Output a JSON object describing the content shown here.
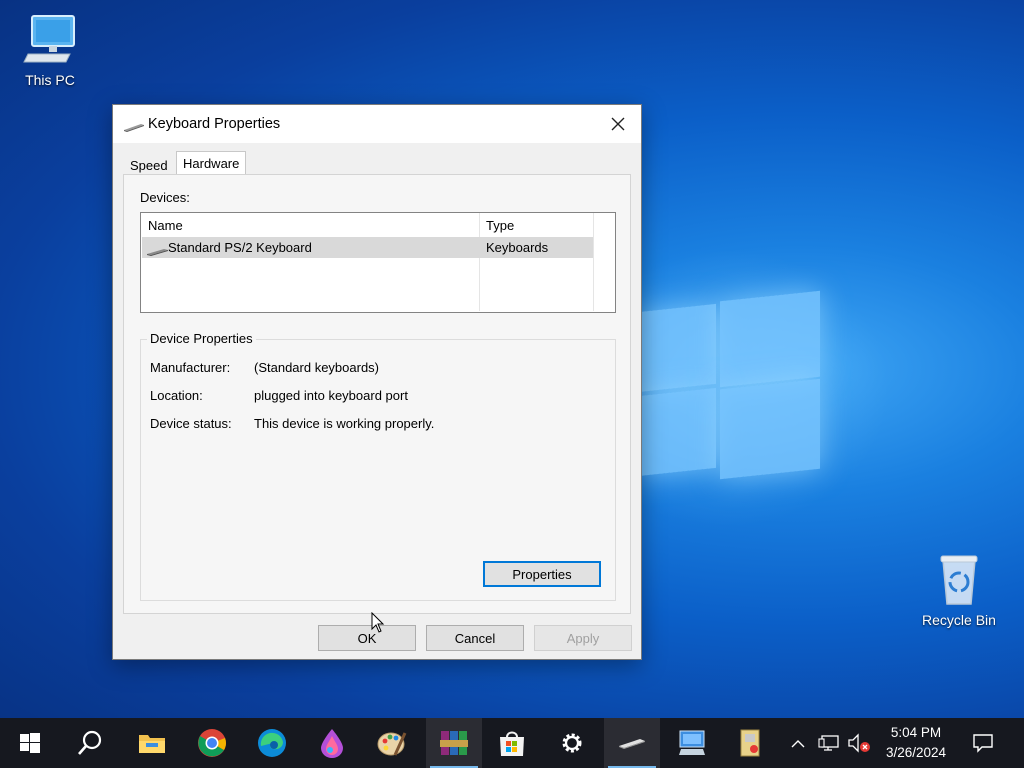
{
  "desktop": {
    "icons": [
      {
        "label": "This PC"
      },
      {
        "label": "Recycle Bin"
      }
    ]
  },
  "dialog": {
    "title": "Keyboard Properties",
    "tabs": [
      {
        "label": "Speed",
        "selected": false
      },
      {
        "label": "Hardware",
        "selected": true
      }
    ],
    "devices_label": "Devices:",
    "columns": {
      "name": "Name",
      "type": "Type"
    },
    "devices": [
      {
        "name": "Standard PS/2 Keyboard",
        "type": "Keyboards",
        "selected": true
      }
    ],
    "device_properties": {
      "legend": "Device Properties",
      "manufacturer_label": "Manufacturer:",
      "manufacturer": "(Standard keyboards)",
      "location_label": "Location:",
      "location": "plugged into keyboard port",
      "status_label": "Device status:",
      "status": "This device is working properly.",
      "properties_button": "Properties"
    },
    "buttons": {
      "ok": "OK",
      "cancel": "Cancel",
      "apply": "Apply"
    }
  },
  "taskbar": {
    "items": [
      "start-icon",
      "search-icon",
      "file-explorer-icon",
      "chrome-icon",
      "edge-icon",
      "paint3d-icon",
      "paint-icon",
      "winrar-icon",
      "store-icon",
      "settings-icon",
      "keyboard-app-icon",
      "remote-desktop-icon",
      "security-app-icon"
    ],
    "tray": [
      "show-hidden-icons-chevron",
      "network-icon",
      "volume-muted-icon"
    ],
    "time": "5:04 PM",
    "date": "3/26/2024",
    "notification": "action-center-icon"
  },
  "colors": {
    "accent": "#0078d7",
    "taskbar": "#16181f"
  }
}
